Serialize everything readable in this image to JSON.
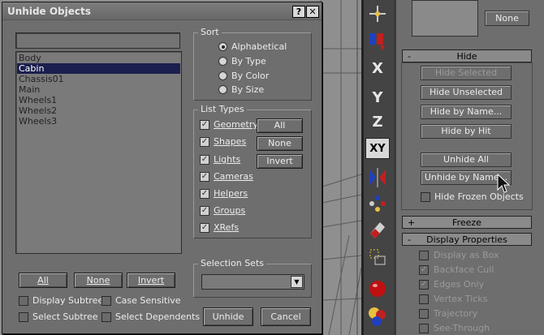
{
  "dialog": {
    "title": "Unhide Objects",
    "help_btn": "?",
    "close_btn": "✕",
    "objects": [
      "Body",
      "Cabin",
      "Chassis01",
      "Main",
      "Wheels1",
      "Wheels2",
      "Wheels3"
    ],
    "selected_index": 1,
    "list_buttons": {
      "all": "All",
      "none": "None",
      "invert": "Invert"
    },
    "options": {
      "display_subtree": "Display Subtree",
      "case_sensitive": "Case Sensitive",
      "select_subtree": "Select Subtree",
      "select_dependents": "Select Dependents"
    },
    "sort": {
      "title": "Sort",
      "options": [
        "Alphabetical",
        "By Type",
        "By Color",
        "By Size"
      ],
      "selected": "Alphabetical"
    },
    "list_types": {
      "title": "List Types",
      "items": [
        "Geometry",
        "Shapes",
        "Lights",
        "Cameras",
        "Helpers",
        "Groups",
        "XRefs"
      ],
      "all": "All",
      "none": "None",
      "invert": "Invert"
    },
    "selection_sets": {
      "title": "Selection Sets",
      "value": ""
    },
    "unhide_btn": "Unhide",
    "cancel_btn": "Cancel"
  },
  "toolbar": {
    "icons": [
      "move-gizmo-icon",
      "select-filter-icon",
      "axis-x",
      "axis-y",
      "axis-z",
      "axis-xy",
      "mirror-icon",
      "array-icon",
      "eraser-icon",
      "align-icon",
      "render-teapot-icon",
      "material-icon"
    ],
    "x": "X",
    "y": "Y",
    "z": "Z",
    "xy": "XY"
  },
  "panel": {
    "none_btn": "None",
    "hide_rollout": {
      "sign": "-",
      "title": "Hide"
    },
    "hide_buttons": [
      "Hide Selected",
      "Hide Unselected",
      "Hide by Name...",
      "Hide by Hit"
    ],
    "unhide_all": "Unhide All",
    "unhide_by_name": "Unhide by Name...",
    "hide_frozen": "Hide Frozen Objects",
    "freeze_rollout": {
      "sign": "+",
      "title": "Freeze"
    },
    "display_rollout": {
      "sign": "-",
      "title": "Display Properties"
    },
    "display_props": [
      "Display as Box",
      "Backface Cull",
      "Edges Only",
      "Vertex Ticks",
      "Trajectory",
      "See-Through"
    ]
  },
  "colors": {
    "selection": "#1b1f4e",
    "panel": "#6e6e6e",
    "viewport": "#8f8f8f"
  }
}
